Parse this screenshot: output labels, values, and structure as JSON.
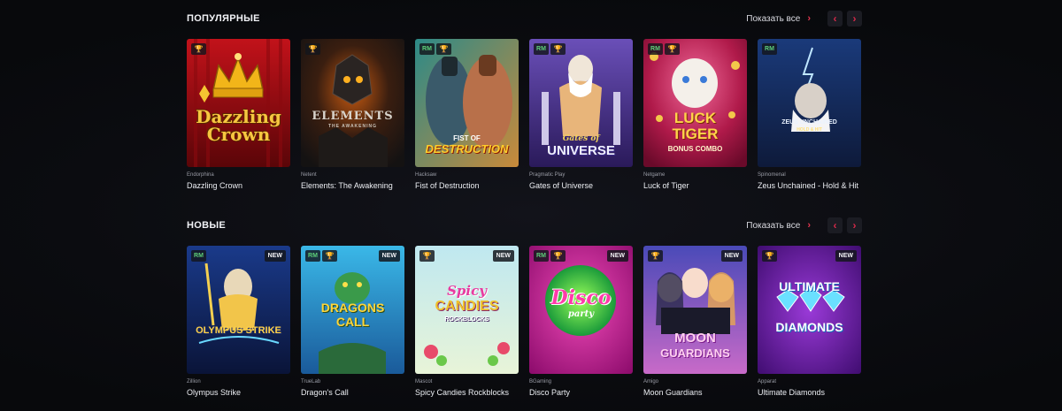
{
  "sections": [
    {
      "title": "ПОПУЛЯРНЫЕ",
      "show_all": "Показать все",
      "games": [
        {
          "provider": "Endorphina",
          "name": "Dazzling Crown",
          "badges": [
            "trophy"
          ],
          "is_new": false,
          "art_text": [
            "Dazzling",
            "Crown"
          ]
        },
        {
          "provider": "Netent",
          "name": "Elements: The Awakening",
          "badges": [
            "trophy"
          ],
          "is_new": false,
          "art_text": [
            "ELEMENTS",
            "THE AWAKENING"
          ]
        },
        {
          "provider": "Hacksaw",
          "name": "Fist of Destruction",
          "badges": [
            "RM",
            "trophy"
          ],
          "is_new": false,
          "art_text": [
            "FIST OF",
            "DESTRUCTION"
          ]
        },
        {
          "provider": "Pragmatic Play",
          "name": "Gates of Universe",
          "badges": [
            "RM",
            "trophy"
          ],
          "is_new": false,
          "art_text": [
            "Gates of",
            "UNIVERSE"
          ]
        },
        {
          "provider": "Netgame",
          "name": "Luck of Tiger",
          "badges": [
            "RM",
            "trophy"
          ],
          "is_new": false,
          "art_text": [
            "LUCK",
            "TIGER",
            "BONUS COMBO"
          ]
        },
        {
          "provider": "Spinomenal",
          "name": "Zeus Unchained - Hold & Hit",
          "badges": [
            "RM"
          ],
          "is_new": false,
          "art_text": [
            "ZEUS UNCHAINED",
            "HOLD & HIT"
          ]
        }
      ]
    },
    {
      "title": "НОВЫЕ",
      "show_all": "Показать все",
      "games": [
        {
          "provider": "Zillion",
          "name": "Olympus Strike",
          "badges": [
            "RM"
          ],
          "is_new": true,
          "art_text": [
            "OLYMPUS STRIKE"
          ]
        },
        {
          "provider": "TrueLab",
          "name": "Dragon's Call",
          "badges": [
            "RM",
            "trophy"
          ],
          "is_new": true,
          "art_text": [
            "DRAGONS",
            "CALL"
          ]
        },
        {
          "provider": "Mascot",
          "name": "Spicy Candies Rockblocks",
          "badges": [
            "trophy"
          ],
          "is_new": true,
          "art_text": [
            "Spicy",
            "CANDIES",
            "ROCKBLOCKS"
          ]
        },
        {
          "provider": "BGaming",
          "name": "Disco Party",
          "badges": [
            "RM",
            "trophy"
          ],
          "is_new": true,
          "art_text": [
            "Disco",
            "party"
          ]
        },
        {
          "provider": "Amigo",
          "name": "Moon Guardians",
          "badges": [
            "trophy"
          ],
          "is_new": true,
          "art_text": [
            "MOON",
            "GUARDIANS"
          ]
        },
        {
          "provider": "Apparat",
          "name": "Ultimate Diamonds",
          "badges": [
            "trophy"
          ],
          "is_new": true,
          "art_text": [
            "ULTIMATE",
            "DIAMONDS"
          ]
        }
      ]
    }
  ],
  "badge_labels": {
    "rm": "RM",
    "new": "NEW"
  },
  "icons": {
    "trophy": "trophy-icon",
    "prev": "chevron-left-icon",
    "next": "chevron-right-icon",
    "show_all": "chevron-right-icon"
  },
  "colors": {
    "background": "#0b0c10",
    "accent": "#e2354f",
    "rm_badge": "#5ed07a",
    "trophy": "#e5c24a",
    "nav_bg": "#1b1c23"
  }
}
